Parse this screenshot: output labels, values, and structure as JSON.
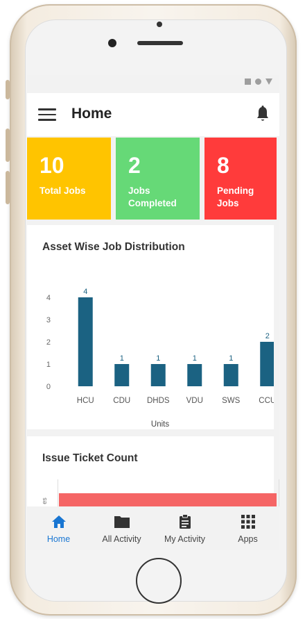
{
  "status_icons": [
    "square-icon",
    "circle-icon",
    "triangle-icon"
  ],
  "appbar": {
    "title": "Home",
    "menu_icon": "menu-icon",
    "bell_icon": "bell-icon"
  },
  "stats": [
    {
      "value": "10",
      "label_line1": "Total Jobs",
      "label_line2": "",
      "color": "#ffc400"
    },
    {
      "value": "2",
      "label_line1": "Jobs",
      "label_line2": "Completed",
      "color": "#66d977"
    },
    {
      "value": "8",
      "label_line1": "Pending",
      "label_line2": "Jobs",
      "color": "#ff3b3b"
    }
  ],
  "asset_chart": {
    "title": "Asset Wise Job Distribution",
    "chart_data": {
      "type": "bar",
      "categories": [
        "HCU",
        "CDU",
        "DHDS",
        "VDU",
        "SWS",
        "CCU"
      ],
      "values": [
        4,
        1,
        1,
        1,
        1,
        2
      ],
      "data_labels": [
        "4",
        "1",
        "1",
        "1",
        "1",
        "2"
      ],
      "yticks": [
        "0",
        "1",
        "2",
        "3",
        "4"
      ],
      "ylim": [
        0,
        4
      ],
      "xlabel": "Units",
      "ylabel": "",
      "bar_color": "#1b6282",
      "grid": false
    }
  },
  "ticket_chart": {
    "title": "Issue Ticket Count",
    "axis_fragment": "es",
    "bar_color": "#f56565"
  },
  "bottom_nav": [
    {
      "label": "Home",
      "icon": "home-icon",
      "active": true
    },
    {
      "label": "All Activity",
      "icon": "folder-icon",
      "active": false
    },
    {
      "label": "My Activity",
      "icon": "clipboard-icon",
      "active": false
    },
    {
      "label": "Apps",
      "icon": "apps-grid-icon",
      "active": false
    }
  ],
  "colors": {
    "accent": "#1976d2",
    "text": "#222222"
  }
}
